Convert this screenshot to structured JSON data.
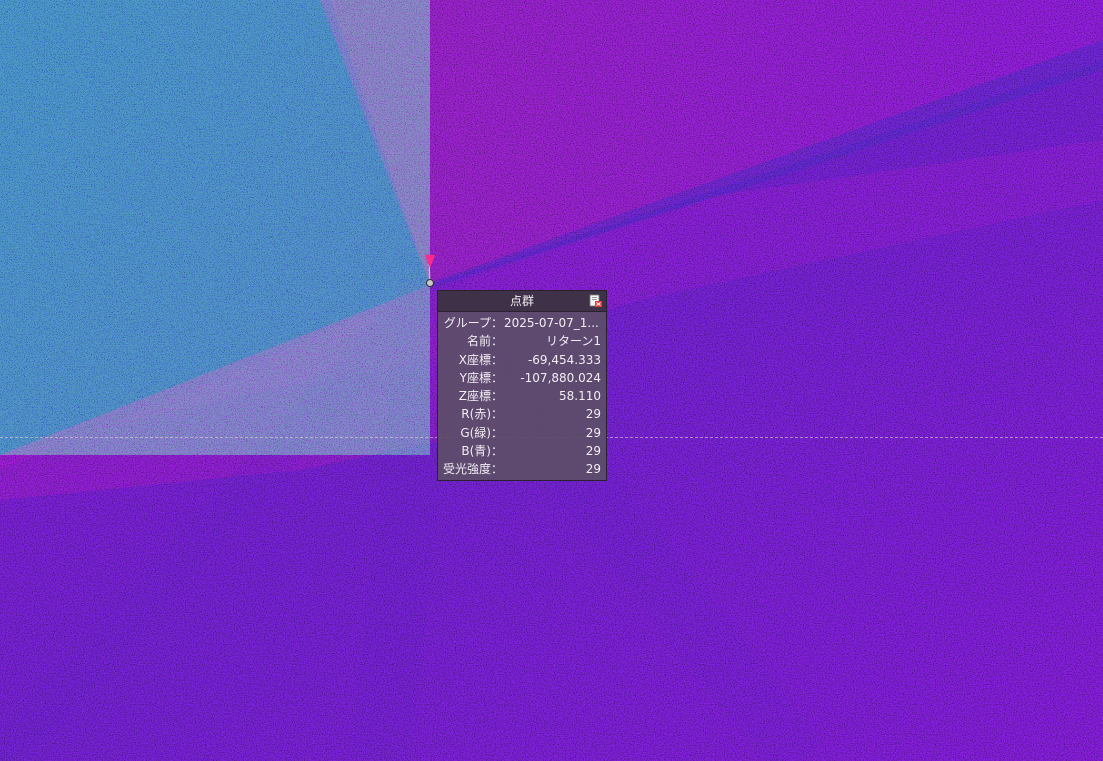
{
  "colors": {
    "cloud_magenta": "#a21fe8",
    "cloud_violet": "#6a2fe0",
    "cloud_blue": "#2a3fd8",
    "panel_bg": "#5c4e68",
    "panel_header": "#3f3248",
    "pin_pink": "#ff2a8a"
  },
  "icons": {
    "pick_marker": "pin-marker-icon",
    "panel_close": "close-window-icon"
  },
  "info_panel": {
    "title": "点群",
    "rows": [
      {
        "label": "グループ：",
        "value": "2025-07-07_1..."
      },
      {
        "label": "名前：",
        "value": "リターン1"
      },
      {
        "label": "X座標：",
        "value": "-69,454.333"
      },
      {
        "label": "Y座標：",
        "value": "-107,880.024"
      },
      {
        "label": "Z座標：",
        "value": "58.110"
      },
      {
        "label": "R(赤)：",
        "value": "29"
      },
      {
        "label": "G(緑)：",
        "value": "29"
      },
      {
        "label": "B(青)：",
        "value": "29"
      },
      {
        "label": "受光強度：",
        "value": "29"
      }
    ]
  }
}
